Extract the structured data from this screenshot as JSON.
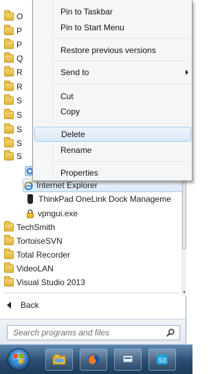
{
  "start_menu": {
    "folders_top": [
      "O",
      "P",
      "P",
      "Q",
      "R",
      "R",
      "S",
      "S",
      "S",
      "S",
      "S"
    ],
    "items": {
      "internet_explorer": "Internet Explorer",
      "thinkpad": "ThinkPad OneLink Dock Manageme",
      "vpngui": "vpngui.exe",
      "techsmith": "TechSmith",
      "tortoise": "TortoiseSVN",
      "total_recorder": "Total Recorder",
      "videolan": "VideoLAN",
      "visual_studio": "Visual Studio 2013"
    },
    "back_label": "Back",
    "search_placeholder": "Search programs and files"
  },
  "context_menu": {
    "items": [
      {
        "label": "Pin to Taskbar"
      },
      {
        "label": "Pin to Start Menu"
      },
      {
        "label": "Restore previous versions"
      },
      {
        "label": "Send to"
      },
      {
        "label": "Cut"
      },
      {
        "label": "Copy"
      },
      {
        "label": "Delete"
      },
      {
        "label": "Rename"
      },
      {
        "label": "Properties"
      }
    ]
  },
  "colors": {
    "highlight_border": "#a9c8ec",
    "taskbar": "#2a4d70"
  },
  "taskbar": {
    "buttons": [
      "windows-explorer-icon",
      "firefox-icon",
      "network-icon",
      "skype-icon"
    ]
  }
}
